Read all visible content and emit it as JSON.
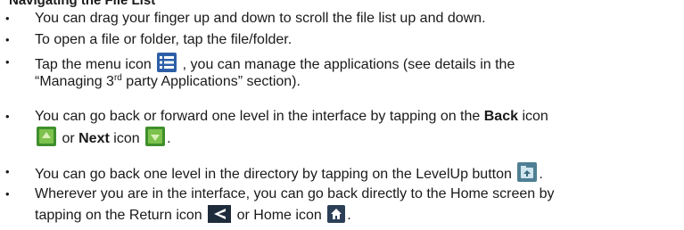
{
  "heading": "Navigating the File List",
  "icons": {
    "menu": "menu-list-icon",
    "back": "green-square-back-icon",
    "next": "green-square-next-icon",
    "levelup": "level-up-folder-icon",
    "return": "return-arrow-icon",
    "home": "home-icon"
  },
  "items": [
    {
      "text": "You can drag your finger up and down to scroll the file list up and down."
    },
    {
      "text": "To open a file or folder, tap the file/folder."
    },
    {
      "l1_pre": "Tap the menu icon ",
      "l1_post": ", you can manage the applications (see details in the",
      "l2_pre": "“Managing 3",
      "l2_sup": "rd",
      "l2_post": " party Applications” section)."
    },
    {
      "l1_pre": "You can go back or forward one level in the interface by tapping on the ",
      "l1_bold": "Back",
      "l1_post": " icon",
      "l2_mid": " or ",
      "l2_bold": "Next",
      "l2_post1": " icon ",
      "l2_end": "."
    },
    {
      "pre": "You can go back one level in the directory by tapping on the LevelUp button ",
      "end": "."
    },
    {
      "l1": "Wherever you are in the interface, you can go back directly to the Home screen by",
      "l2_pre": "tapping on the Return icon ",
      "l2_mid": " or Home icon ",
      "l2_end": "."
    }
  ]
}
